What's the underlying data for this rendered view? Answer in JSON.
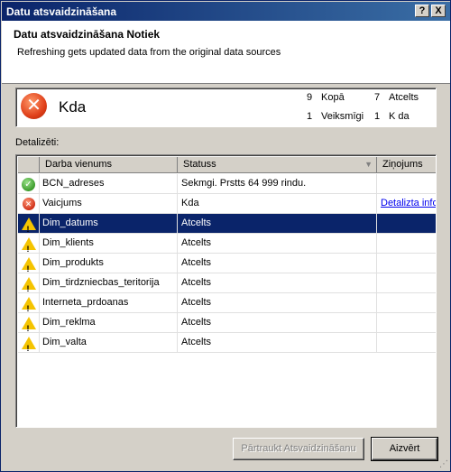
{
  "window": {
    "title": "Datu atsvaidzināšana",
    "help_glyph": "?",
    "close_glyph": "X"
  },
  "header": {
    "title": "Datu atsvaidzināšana Notiek",
    "subtitle": "Refreshing gets updated data from the original data sources"
  },
  "summary": {
    "icon": "error-x-icon",
    "status": "Kda",
    "total_count": "9",
    "total_label": "Kopā",
    "cancelled_count": "7",
    "cancelled_label": "Atcelts",
    "success_count": "1",
    "success_label": "Veiksmīgi",
    "error_count": "1",
    "error_label": "K da"
  },
  "details": {
    "label": "Detalizēti:",
    "columns": [
      "Darba vienums",
      "Statuss",
      "Ziņojums"
    ],
    "rows": [
      {
        "icon": "success",
        "name": "BCN_adreses",
        "status": "Sekmgi. Prstts 64 999 rindu.",
        "message": "",
        "selected": false
      },
      {
        "icon": "error",
        "name": "Vaicjums",
        "status": "Kda",
        "message": "Detalizta informcija",
        "selected": false
      },
      {
        "icon": "warning",
        "name": "Dim_datums",
        "status": "Atcelts",
        "message": "",
        "selected": true
      },
      {
        "icon": "warning",
        "name": "Dim_klients",
        "status": "Atcelts",
        "message": "",
        "selected": false
      },
      {
        "icon": "warning",
        "name": "Dim_produkts",
        "status": "Atcelts",
        "message": "",
        "selected": false
      },
      {
        "icon": "warning",
        "name": "Dim_tirdzniecbas_teritorija",
        "status": "Atcelts",
        "message": "",
        "selected": false
      },
      {
        "icon": "warning",
        "name": "Interneta_prdoanas",
        "status": "Atcelts",
        "message": "",
        "selected": false
      },
      {
        "icon": "warning",
        "name": "Dim_reklma",
        "status": "Atcelts",
        "message": "",
        "selected": false
      },
      {
        "icon": "warning",
        "name": "Dim_valta",
        "status": "Atcelts",
        "message": "",
        "selected": false
      }
    ]
  },
  "buttons": {
    "stop": "Pārtraukt Atsvaidzināšanu",
    "close": "Aizvērt"
  }
}
